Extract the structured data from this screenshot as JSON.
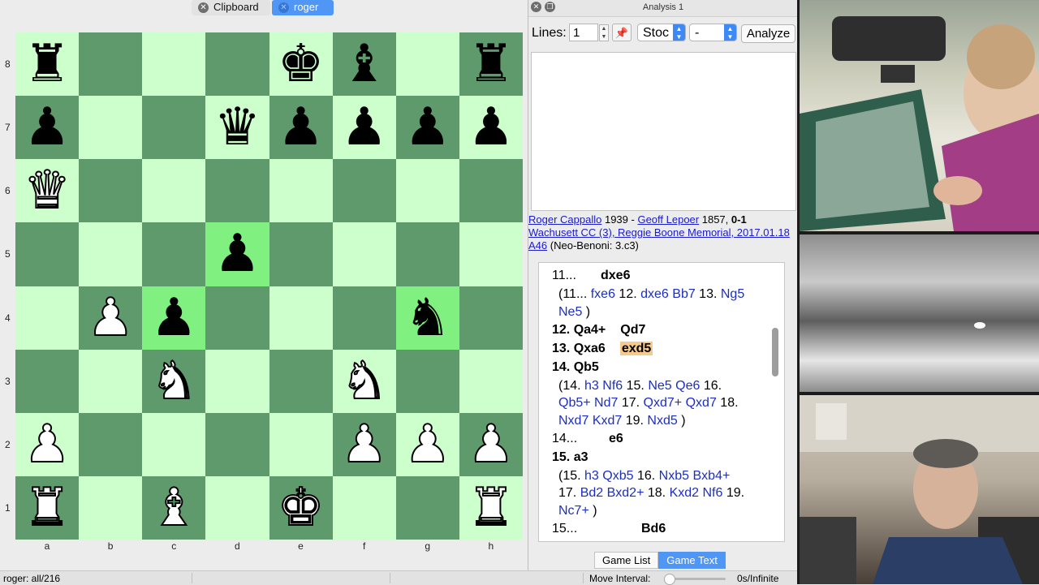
{
  "tabs": [
    {
      "label": "Clipboard",
      "active": false
    },
    {
      "label": "roger",
      "active": true
    }
  ],
  "board": {
    "ranks": [
      "8",
      "7",
      "6",
      "5",
      "4",
      "3",
      "2",
      "1"
    ],
    "files": [
      "a",
      "b",
      "c",
      "d",
      "e",
      "f",
      "g",
      "h"
    ],
    "position": [
      [
        "r",
        "",
        "",
        "",
        "k",
        "b",
        "",
        "r"
      ],
      [
        "p",
        "",
        "",
        "q",
        "p",
        "p",
        "p",
        "p"
      ],
      [
        "Q",
        "",
        "",
        "",
        "",
        "",
        "",
        ""
      ],
      [
        "",
        "",
        "",
        "p",
        "",
        "",
        "",
        ""
      ],
      [
        "",
        "P",
        "p",
        "",
        "",
        "",
        "n",
        ""
      ],
      [
        "",
        "",
        "N",
        "",
        "",
        "N",
        "",
        ""
      ],
      [
        "P",
        "",
        "",
        "",
        "",
        "P",
        "P",
        "P"
      ],
      [
        "R",
        "",
        "B",
        "",
        "K",
        "",
        "",
        "R"
      ]
    ],
    "highlighted_squares": [
      "d5",
      "c4",
      "g4"
    ],
    "light_color": "#ccffcc",
    "dark_color": "#5f9a6c",
    "highlight_color": "#80f080"
  },
  "analysis": {
    "window_title": "Analysis 1",
    "lines_label": "Lines:",
    "lines_value": "1",
    "engine": "Stoc",
    "dash": "-",
    "analyze_label": "Analyze"
  },
  "game": {
    "white": "Roger Cappallo",
    "white_elo": "1939",
    "black": "Geoff Lepoer",
    "black_elo": "1857",
    "result": "0-1",
    "event": "Wachusett CC (3), Reggie Boone Memorial, 2017.01.18",
    "eco": "A46",
    "opening": "(Neo-Benoni: 3.c3)"
  },
  "notation": {
    "lines": [
      [
        {
          "t": "11...",
          "c": "num"
        },
        {
          "t": "dxe6",
          "c": "mv"
        }
      ],
      [
        {
          "t": "(11... ",
          "c": "plain"
        },
        {
          "t": "fxe6",
          "c": "var"
        },
        {
          "t": " 12. ",
          "c": "plain"
        },
        {
          "t": "dxe6",
          "c": "var"
        },
        {
          "t": " ",
          "c": "plain"
        },
        {
          "t": "Bb7",
          "c": "var"
        },
        {
          "t": " 13. ",
          "c": "plain"
        },
        {
          "t": "Ng5",
          "c": "var"
        }
      ],
      [
        {
          "t": "Ne5",
          "c": "var"
        },
        {
          "t": " )",
          "c": "plain"
        }
      ],
      [
        {
          "t": "12. ",
          "c": "mv"
        },
        {
          "t": "Qa4+",
          "c": "mv"
        },
        {
          "t": "Qd7",
          "c": "mv"
        }
      ],
      [
        {
          "t": "13. ",
          "c": "mv"
        },
        {
          "t": "Qxa6",
          "c": "mv"
        },
        {
          "t": "exd5",
          "c": "cur"
        }
      ],
      [
        {
          "t": "14. ",
          "c": "mv"
        },
        {
          "t": "Qb5",
          "c": "mv"
        }
      ],
      [
        {
          "t": "(14. ",
          "c": "plain"
        },
        {
          "t": "h3",
          "c": "var"
        },
        {
          "t": " ",
          "c": "plain"
        },
        {
          "t": "Nf6",
          "c": "var"
        },
        {
          "t": " 15. ",
          "c": "plain"
        },
        {
          "t": "Ne5",
          "c": "var"
        },
        {
          "t": " ",
          "c": "plain"
        },
        {
          "t": "Qe6",
          "c": "var"
        },
        {
          "t": " 16.",
          "c": "plain"
        }
      ],
      [
        {
          "t": "Qb5+",
          "c": "var"
        },
        {
          "t": " ",
          "c": "plain"
        },
        {
          "t": "Nd7",
          "c": "var"
        },
        {
          "t": " 17. ",
          "c": "plain"
        },
        {
          "t": "Qxd7+",
          "c": "var"
        },
        {
          "t": " ",
          "c": "plain"
        },
        {
          "t": "Qxd7",
          "c": "var"
        },
        {
          "t": " 18.",
          "c": "plain"
        }
      ],
      [
        {
          "t": "Nxd7",
          "c": "var"
        },
        {
          "t": " ",
          "c": "plain"
        },
        {
          "t": "Kxd7",
          "c": "var"
        },
        {
          "t": " 19. ",
          "c": "plain"
        },
        {
          "t": "Nxd5",
          "c": "var"
        },
        {
          "t": " )",
          "c": "plain"
        }
      ],
      [
        {
          "t": "14...",
          "c": "num"
        },
        {
          "t": "e6",
          "c": "mv"
        }
      ],
      [
        {
          "t": "15. ",
          "c": "mv"
        },
        {
          "t": "a3",
          "c": "mv"
        }
      ],
      [
        {
          "t": "(15. ",
          "c": "plain"
        },
        {
          "t": "h3",
          "c": "var"
        },
        {
          "t": " ",
          "c": "plain"
        },
        {
          "t": "Qxb5",
          "c": "var"
        },
        {
          "t": " 16. ",
          "c": "plain"
        },
        {
          "t": "Nxb5",
          "c": "var"
        },
        {
          "t": " ",
          "c": "plain"
        },
        {
          "t": "Bxb4+",
          "c": "var"
        }
      ],
      [
        {
          "t": "17. ",
          "c": "plain"
        },
        {
          "t": "Bd2",
          "c": "var"
        },
        {
          "t": " ",
          "c": "plain"
        },
        {
          "t": "Bxd2+",
          "c": "var"
        },
        {
          "t": " 18. ",
          "c": "plain"
        },
        {
          "t": "Kxd2",
          "c": "var"
        },
        {
          "t": " ",
          "c": "plain"
        },
        {
          "t": "Nf6",
          "c": "var"
        },
        {
          "t": " 19.",
          "c": "plain"
        }
      ],
      [
        {
          "t": "Nc7+",
          "c": "var"
        },
        {
          "t": " )",
          "c": "plain"
        }
      ],
      [
        {
          "t": "15...",
          "c": "num"
        },
        {
          "t": "Bd6",
          "c": "mv"
        }
      ]
    ]
  },
  "bottom_tabs": [
    {
      "label": "Game List",
      "active": false
    },
    {
      "label": "Game Text",
      "active": true
    }
  ],
  "status": {
    "text": "roger: all/216",
    "move_interval_label": "Move Interval:",
    "move_interval_value": "0s/Infinite"
  },
  "icons": {
    "tab_close": "close-icon",
    "pin": "pin-icon",
    "stepper": "stepper-icon"
  }
}
